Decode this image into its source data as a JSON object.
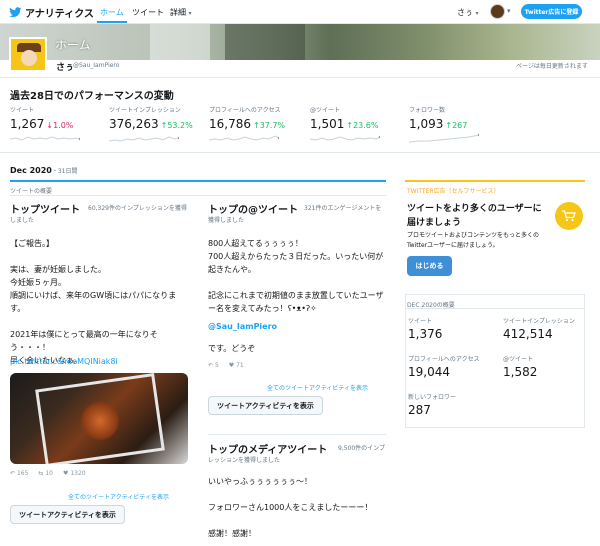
{
  "nav": {
    "brand": "アナリティクス",
    "home": "ホーム",
    "tweets": "ツイート",
    "more": "詳細",
    "user": "さぅ",
    "ad_button": "Twitter広告に登録"
  },
  "profile": {
    "page_title": "ホーム",
    "name": "さぅ",
    "handle": "@Sau_IamPiero",
    "update_note": "ページは毎日更新されます"
  },
  "performance": {
    "title": "過去28日でのパフォーマンスの変動",
    "stats": [
      {
        "label": "ツイート",
        "value": "1,267",
        "arrow": "↓",
        "change": "1.0%",
        "direction": "down"
      },
      {
        "label": "ツイートインプレッション",
        "value": "376,263",
        "arrow": "↑",
        "change": "53.2%",
        "direction": "up"
      },
      {
        "label": "プロフィールへのアクセス",
        "value": "16,786",
        "arrow": "↑",
        "change": "37.7%",
        "direction": "up"
      },
      {
        "label": "@ツイート",
        "value": "1,501",
        "arrow": "↑",
        "change": "23.6%",
        "direction": "up"
      },
      {
        "label": "フォロワー数",
        "value": "1,093",
        "arrow": "↑",
        "change": "267",
        "direction": "up"
      }
    ]
  },
  "month": {
    "label": "Dec 2020",
    "days": "・31日間",
    "summary_label": "ツイートの概要"
  },
  "top_tweet": {
    "title": "トップツイート",
    "sub": "60,329件のインプレッションを獲得しました",
    "text": "【ご報告。】\n\n実は、妻が妊娠しました。\n今妊娠５ヶ月。\n順調にいけば、来年のGW頃にはパパになります。\n\n2021年は僕にとって最高の一年になりそう・・・！\n早く会いたいなぁ。",
    "link": "pic.twitter.com/eMQINiak8i",
    "replies": "165",
    "retweets": "10",
    "likes": "1320",
    "all_activity": "全てのツイートアクティビティを表示",
    "button": "ツイートアクティビティを表示"
  },
  "top_mention": {
    "title": "トップの@ツイート",
    "sub": "321件のエンゲージメントを獲得しました",
    "text": "800人超えてるぅぅぅぅ！\n700人超えからたった３日だった。いったい何が起きたんや。\n\n記念にこれまで初期値のまま放置していたユーザー名を変えてみたっ！ʕ•ᴥ•ʔ✧",
    "mention": "@Sau_IamPiero",
    "text2": "です。どうぞ",
    "replies": "5",
    "likes": "71",
    "all_activity": "全てのツイートアクティビティを表示",
    "button": "ツイートアクティビティを表示"
  },
  "top_media": {
    "title": "トップのメディアツイート",
    "sub": "9,500件のインプレッションを獲得しました",
    "text": "いいやっふぅぅぅぅぅぅ〜！\n\nフォロワーさん1000人をこえましたーーー！\n\n感謝！感謝！"
  },
  "sidebar": {
    "promo_label": "TWITTER広告（セルフサービス）",
    "title": "ツイートをより多くのユーザーに届けましょう",
    "desc": "プロモツイートおよびコンテンツをもっと多くのTwitterユーザーに届けましょう。",
    "start_button": "はじめる",
    "summary_label": "DEC 2020の概要",
    "stats": [
      {
        "label": "ツイート",
        "value": "1,376"
      },
      {
        "label": "ツイートインプレッション",
        "value": "412,514"
      },
      {
        "label": "プロフィールへのアクセス",
        "value": "19,044"
      },
      {
        "label": "@ツイート",
        "value": "1,582"
      },
      {
        "label": "新しいフォロワー",
        "value": "287"
      }
    ]
  },
  "colors": {
    "accent": "#1da1f2",
    "up": "#17bf63",
    "down": "#e0245e",
    "promo": "#f5c518"
  }
}
